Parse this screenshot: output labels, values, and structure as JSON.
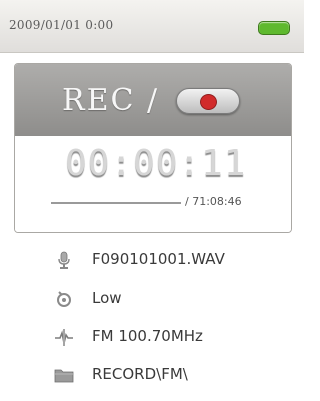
{
  "status_bar": {
    "datetime": "2009/01/01   0:00",
    "battery_icon": "battery-full-icon",
    "battery_color": "#5fb92e"
  },
  "recorder": {
    "title": "REC /",
    "record_indicator_icon": "record-dot-icon",
    "record_color": "#d12a2a",
    "elapsed": "00:00:11",
    "total": "/ 71:08:46",
    "progress_fraction": 0.0
  },
  "info": {
    "filename": "F090101001.WAV",
    "quality": "Low",
    "source": "FM 100.70MHz",
    "folder": "RECORD\\FM\\"
  },
  "icons": {
    "file": "microphone-icon",
    "quality": "quality-icon",
    "source": "fm-antenna-icon",
    "folder": "folder-icon"
  }
}
